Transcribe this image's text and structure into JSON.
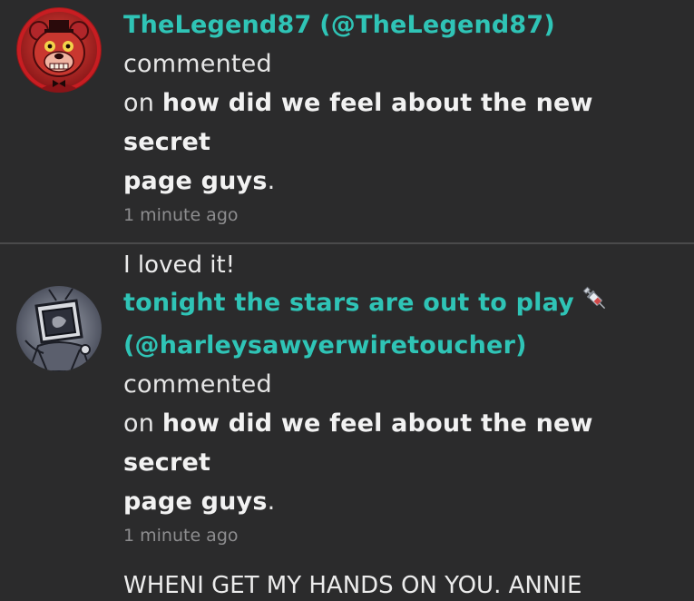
{
  "notifications": [
    {
      "display_name": "TheLegend87",
      "handle": "(@TheLegend87)",
      "action": "commented",
      "preposition": "on",
      "post_title": "how did we feel about the new secret",
      "post_title_cont": "page guys",
      "period": ".",
      "time": "1 minute ago",
      "comment": "I loved it!",
      "avatar_icon": "freddy-bear-avatar-icon"
    },
    {
      "display_name": "tonight the stars are out to play",
      "emoji": "syringe",
      "handle": "(@harleysawyerwiretoucher)",
      "action": "commented",
      "preposition": "on",
      "post_title": "how did we feel about the new secret",
      "post_title_cont": "page guys",
      "period": ".",
      "time": "1 minute ago",
      "comment": "WHENI GET MY HANDS ON YOU. ANNIE",
      "avatar_icon": "tv-head-avatar-icon"
    }
  ],
  "colors": {
    "background": "#2b2b2c",
    "username": "#2fc4b6",
    "muted": "#8d8d8f",
    "divider": "#4a4a4b"
  }
}
